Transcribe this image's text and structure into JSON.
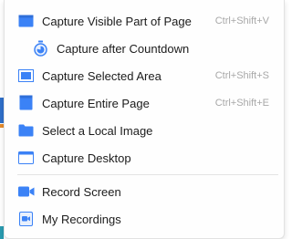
{
  "menu": {
    "items": [
      {
        "label": "Capture Visible Part of Page",
        "shortcut": "Ctrl+Shift+V",
        "icon": "visible-page-icon"
      },
      {
        "label": "Capture after Countdown",
        "shortcut": "",
        "icon": "timer-icon"
      },
      {
        "label": "Capture Selected Area",
        "shortcut": "Ctrl+Shift+S",
        "icon": "selected-area-icon"
      },
      {
        "label": "Capture Entire Page",
        "shortcut": "Ctrl+Shift+E",
        "icon": "entire-page-icon"
      },
      {
        "label": "Select a Local Image",
        "shortcut": "",
        "icon": "folder-icon"
      },
      {
        "label": "Capture Desktop",
        "shortcut": "",
        "icon": "desktop-icon"
      },
      {
        "label": "Record Screen",
        "shortcut": "",
        "icon": "video-camera-icon"
      },
      {
        "label": "My Recordings",
        "shortcut": "",
        "icon": "recordings-icon"
      }
    ]
  },
  "colors": {
    "accent": "#3b82f6",
    "icon_light": "#e8f0fd",
    "text": "#1b1b1b",
    "shortcut": "#a8a8a8"
  }
}
